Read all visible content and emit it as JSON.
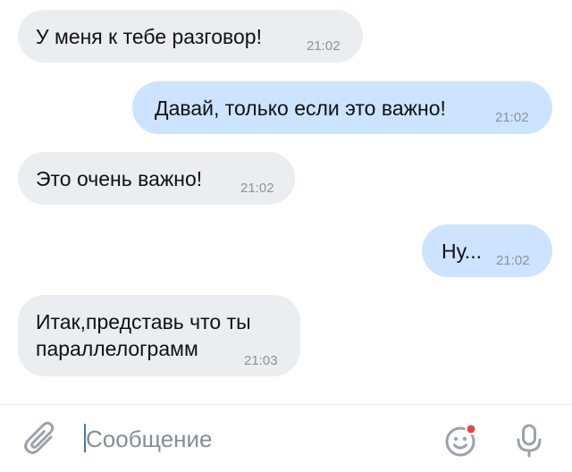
{
  "messages": [
    {
      "direction": "incoming",
      "text": "У меня к тебе разговор!",
      "time": "21:02"
    },
    {
      "direction": "outgoing",
      "text": "Давай, только если это важно!",
      "time": "21:02"
    },
    {
      "direction": "incoming",
      "text": "Это очень важно!",
      "time": "21:02"
    },
    {
      "direction": "outgoing",
      "text": "Ну...",
      "time": "21:02"
    },
    {
      "direction": "incoming",
      "text_lines": [
        "Итак,представь что ты",
        "параллелограмм"
      ],
      "time": "21:03"
    }
  ],
  "composer": {
    "placeholder": "Сообщение",
    "value": "",
    "attach_icon": "paperclip-icon",
    "emoji_icon": "emoji-icon",
    "mic_icon": "microphone-icon"
  },
  "colors": {
    "incoming_bubble": "#ebedf0",
    "outgoing_bubble": "#cce4ff",
    "timestamp": "#8c9199",
    "icon": "#99a2ad",
    "notification_dot": "#e64646",
    "caret": "#4a76a8"
  }
}
